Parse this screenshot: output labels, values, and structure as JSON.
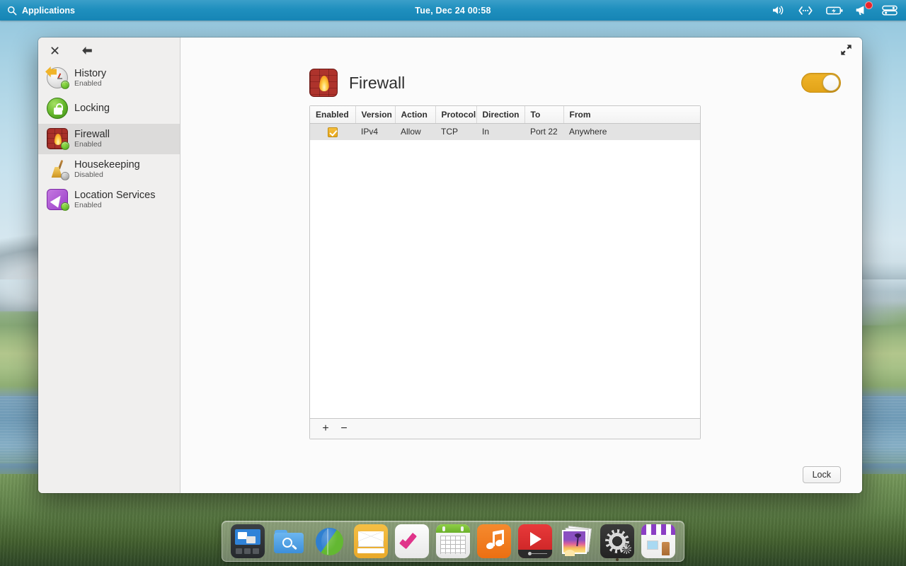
{
  "menubar": {
    "applications_label": "Applications",
    "search_icon": "search-icon",
    "clock": "Tue, Dec 24   00:58",
    "tray": [
      {
        "name": "volume-icon",
        "glyph": "volume"
      },
      {
        "name": "network-icon",
        "glyph": "network"
      },
      {
        "name": "battery-icon",
        "glyph": "battery-charging"
      },
      {
        "name": "notifications-icon",
        "glyph": "bell",
        "badge": true
      },
      {
        "name": "control-center-icon",
        "glyph": "toggle"
      }
    ]
  },
  "window": {
    "close_label": "✕",
    "back_label": "←",
    "expand_label": "expand-icon"
  },
  "sidebar": {
    "items": [
      {
        "label": "History",
        "status": "Enabled",
        "icon": "history-icon",
        "state": "on",
        "selected": false
      },
      {
        "label": "Locking",
        "status": "",
        "icon": "lock-icon",
        "state": "none",
        "selected": false
      },
      {
        "label": "Firewall",
        "status": "Enabled",
        "icon": "firewall-icon",
        "state": "on",
        "selected": true
      },
      {
        "label": "Housekeeping",
        "status": "Disabled",
        "icon": "broom-icon",
        "state": "off",
        "selected": false
      },
      {
        "label": "Location Services",
        "status": "Enabled",
        "icon": "location-icon",
        "state": "on",
        "selected": false
      }
    ]
  },
  "panel": {
    "title": "Firewall",
    "icon": "firewall-icon",
    "toggle_on": true,
    "toggle_name": "firewall-enable-toggle"
  },
  "table": {
    "columns": [
      "Enabled",
      "Version",
      "Action",
      "Protocol",
      "Direction",
      "To",
      "From"
    ],
    "rows": [
      {
        "enabled": true,
        "version": "IPv4",
        "action": "Allow",
        "protocol": "TCP",
        "direction": "In",
        "to": "Port 22",
        "from": "Anywhere"
      }
    ],
    "add_label": "+",
    "remove_label": "−"
  },
  "footer": {
    "lock_label": "Lock"
  },
  "dock": {
    "items": [
      {
        "name": "mission-control",
        "class": "d-mission",
        "running": false
      },
      {
        "name": "file-manager",
        "class": "d-finder",
        "running": false
      },
      {
        "name": "web-browser",
        "class": "d-web",
        "running": false
      },
      {
        "name": "mail",
        "class": "d-mail",
        "running": false
      },
      {
        "name": "tasks",
        "class": "d-task",
        "running": false
      },
      {
        "name": "calendar",
        "class": "d-cal",
        "running": false
      },
      {
        "name": "music",
        "class": "d-music",
        "running": false
      },
      {
        "name": "video-player",
        "class": "d-video",
        "running": false
      },
      {
        "name": "photos",
        "class": "d-photo",
        "running": false
      },
      {
        "name": "system-settings",
        "class": "d-settings",
        "running": true
      },
      {
        "name": "app-store",
        "class": "d-store",
        "running": false
      }
    ]
  },
  "colors": {
    "accent_amber": "#f0b429",
    "menubar_blue": "#1f8fbe",
    "selected_row": "#dcdbda",
    "table_row": "#e3e3e3"
  }
}
